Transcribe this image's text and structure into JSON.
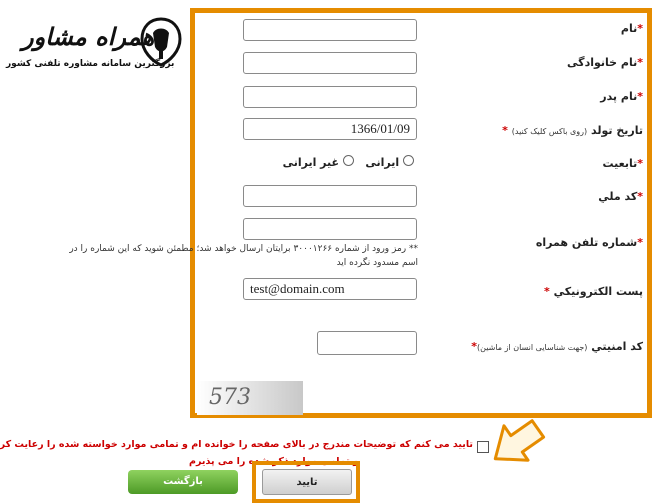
{
  "logo": {
    "title": "همراه مشاور",
    "subtitle": "بزرگترین سامانه مشاوره تلفنی کشور"
  },
  "form": {
    "first_name": {
      "label": "نام",
      "star": "*",
      "value": ""
    },
    "last_name": {
      "label": "نام خانوادگی",
      "star": "*",
      "value": ""
    },
    "father_name": {
      "label": "نام پدر",
      "star": "*",
      "value": ""
    },
    "birth_date": {
      "label": "تاریخ تولد",
      "hint": "(روی باکس کلیک کنید)",
      "star": "*",
      "value": "1366/01/09"
    },
    "nationality": {
      "label": "تابعیت",
      "star": "*",
      "options": [
        "ایرانی",
        "غیر ایرانی"
      ]
    },
    "national_code": {
      "label": "کد ملي",
      "star": "*",
      "value": ""
    },
    "mobile": {
      "label": "شماره تلفن همراه",
      "star": "*",
      "value": "",
      "note_line1": "** رمز ورود از شماره ۳۰۰۰۱۲۶۶ برایتان ارسال خواهد شد؛ مطمئن شوید که این شماره را در",
      "note_line2": "اسم مسدود نگرده اید"
    },
    "email": {
      "label": "پست الکترونيکي",
      "star": "*",
      "value": "test@domain.com"
    },
    "security_code": {
      "label": "کد امنيتي",
      "hint": "(جهت شناسایی انسان از ماشین)",
      "star": "*",
      "value": ""
    },
    "captcha_text": "573"
  },
  "confirm": {
    "line1": "تایید می کنم که توضیحات مندرج در بالای صفحه را خوانده ام و تمامی موارد خواسته شده را رعایت کرده ام",
    "line2": "و تمامی موارد ذکر شده را می پذیرم"
  },
  "buttons": {
    "back": "بازگشت",
    "submit": "تایید"
  },
  "colors": {
    "highlight": "#e58c00",
    "required": "#cc0000",
    "back_button": "#5aa82f"
  }
}
